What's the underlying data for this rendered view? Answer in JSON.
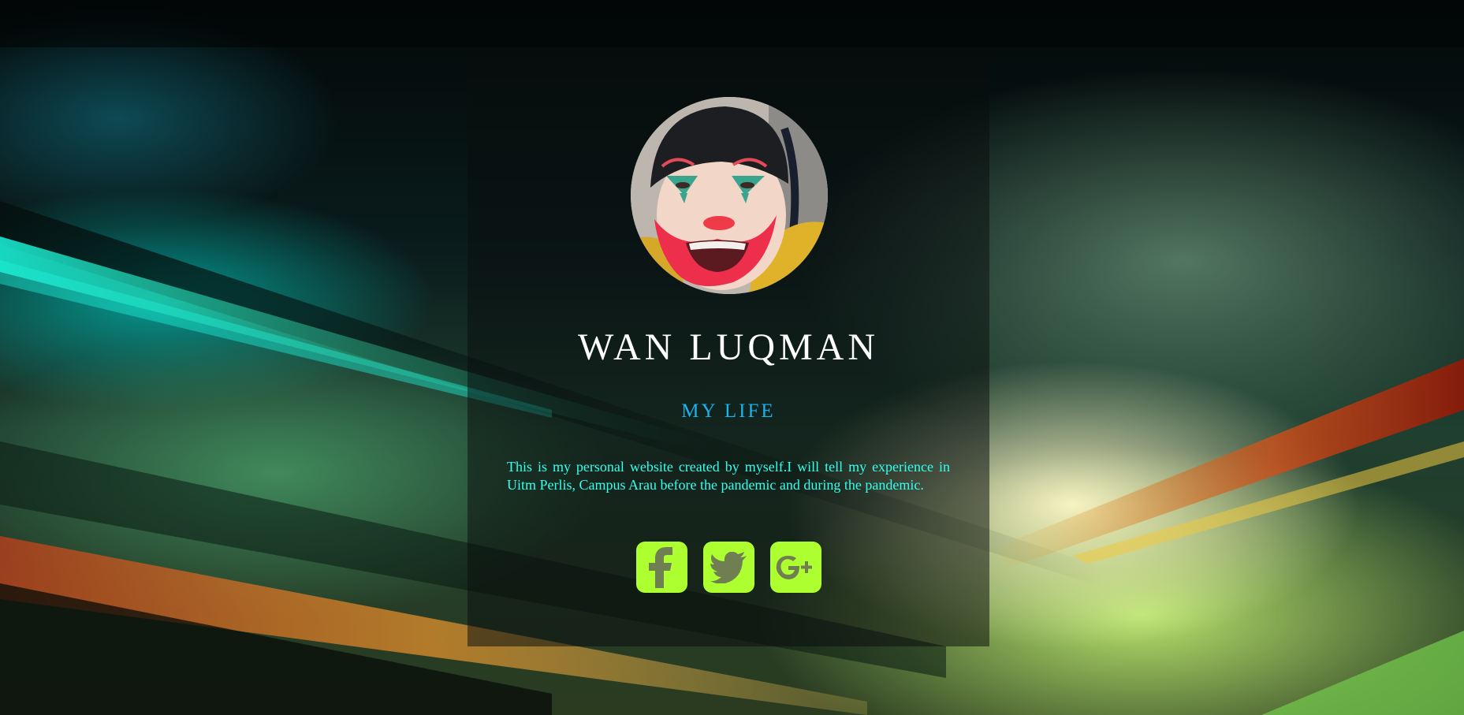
{
  "profile": {
    "name": "WAN LUQMAN",
    "subtitle": "MY LIFE",
    "bio": "This is my personal website created by myself.I will tell my experience in Uitm Perlis, Campus Arau before the pandemic and during the pandemic."
  },
  "social_links": [
    {
      "icon": "facebook-icon",
      "label": "Facebook"
    },
    {
      "icon": "twitter-icon",
      "label": "Twitter"
    },
    {
      "icon": "google-plus-icon",
      "label": "Google+"
    }
  ],
  "colors": {
    "name": "#ffffff",
    "subtitle": "#19b3ee",
    "bio": "#33ffee",
    "social_button": "#adff2f",
    "social_glyph": "#707f52"
  }
}
